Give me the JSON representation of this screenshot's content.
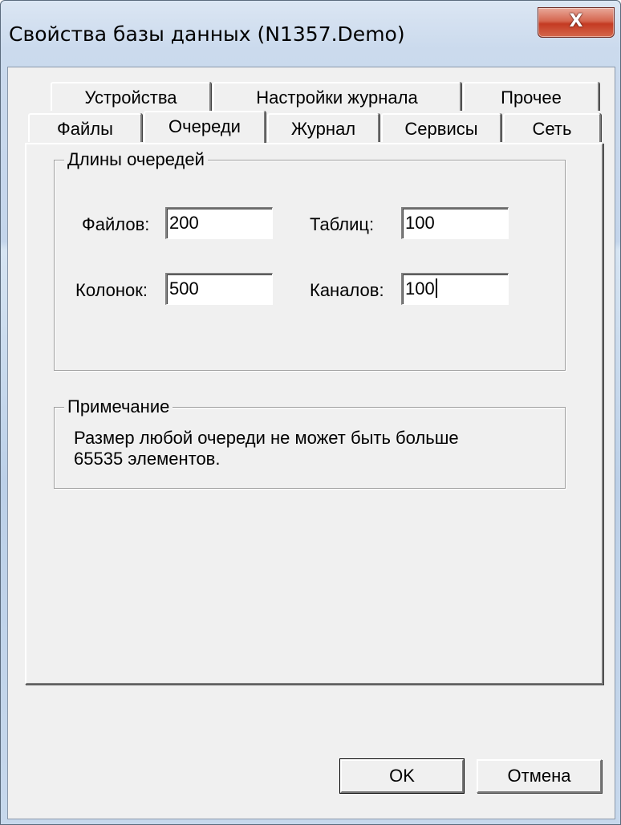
{
  "window": {
    "title": "Свойства базы данных (N1357.Demo)",
    "close_glyph": "X",
    "close_icon": "close-icon"
  },
  "tabs": {
    "row_back": [
      {
        "label": "Устройства"
      },
      {
        "label": "Настройки журнала"
      },
      {
        "label": "Прочее"
      }
    ],
    "row_front": [
      {
        "label": "Файлы"
      },
      {
        "label": "Очереди"
      },
      {
        "label": "Журнал"
      },
      {
        "label": "Сервисы"
      },
      {
        "label": "Сеть"
      }
    ],
    "active": "Очереди"
  },
  "queue_lengths": {
    "legend": "Длины очередей",
    "files_label": "Файлов:",
    "files_value": "200",
    "tables_label": "Таблиц:",
    "tables_value": "100",
    "columns_label": "Колонок:",
    "columns_value": "500",
    "channels_label": "Каналов:",
    "channels_value": "100"
  },
  "note": {
    "legend": "Примечание",
    "text": "Размер любой очереди не может быть больше 65535 элементов."
  },
  "buttons": {
    "ok": "OK",
    "cancel": "Отмена"
  },
  "colors": {
    "face": "#f0f0f0",
    "close_button": "#c43a22",
    "frame": "#c4d5eb"
  }
}
